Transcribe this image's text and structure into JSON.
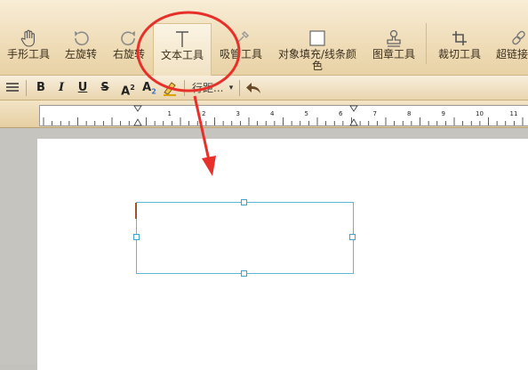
{
  "toolbar": {
    "tools": [
      {
        "label": "手形工具",
        "icon": "hand-icon"
      },
      {
        "label": "左旋转",
        "icon": "rotate-left-icon"
      },
      {
        "label": "右旋转",
        "icon": "rotate-right-icon"
      },
      {
        "label": "文本工具",
        "icon": "text-tool-icon"
      },
      {
        "label": "吸管工具",
        "icon": "eyedropper-icon"
      },
      {
        "label": "对象填充/线条颜",
        "label2": "色",
        "icon": "fill-color-icon"
      },
      {
        "label": "图章工具",
        "icon": "stamp-icon"
      },
      {
        "label": "裁切工具",
        "icon": "crop-icon"
      },
      {
        "label": "超链接",
        "icon": "hyperlink-icon"
      }
    ]
  },
  "format": {
    "bold": "B",
    "italic": "I",
    "underline": "U",
    "strike": "S",
    "superscript": "A",
    "superscript_mark": "2",
    "subscript": "A",
    "subscript_mark": "2",
    "line_spacing": "行距...",
    "dropdown": "▾"
  },
  "ruler": {
    "labels": [
      "1",
      "2",
      "3",
      "4",
      "5",
      "6",
      "7",
      "8",
      "9",
      "10",
      "11"
    ]
  },
  "colors": {
    "annotation": "#e8302a",
    "selection": "#5fb6d8",
    "toolbar": "#efdcb7"
  }
}
